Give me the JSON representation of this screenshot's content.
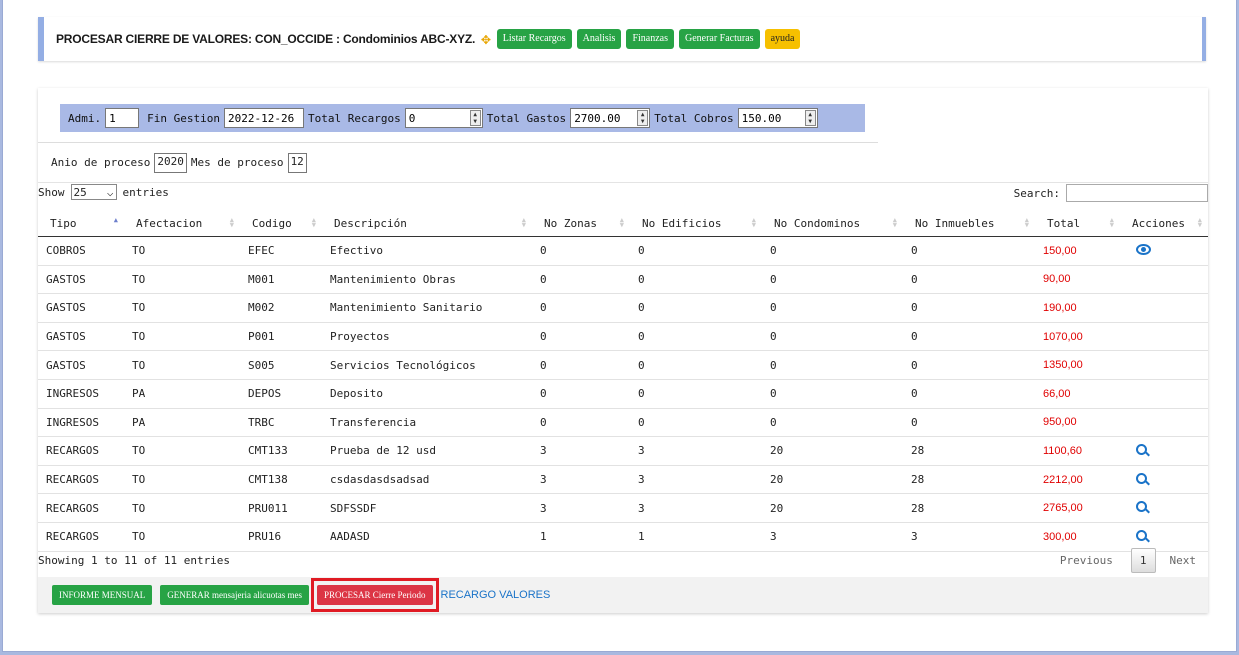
{
  "header": {
    "title": "PROCESAR CIERRE DE VALORES: CON_OCCIDE : Condominios ABC-XYZ.",
    "buttons": [
      "Listar Recargos",
      "Analisis",
      "Finanzas",
      "Generar Facturas"
    ],
    "help": "ayuda"
  },
  "params": {
    "admi_label": "Admi.",
    "admi_value": "1",
    "fin_label": "Fin Gestion",
    "fin_value": "2022-12-26",
    "recargos_label": "Total Recargos",
    "recargos_value": "0",
    "gastos_label": "Total Gastos",
    "gastos_value": "2700.00",
    "cobros_label": "Total Cobros",
    "cobros_value": "150.00",
    "anio_label": "Anio de proceso",
    "anio_value": "2020",
    "mes_label": "Mes de proceso",
    "mes_value": "12"
  },
  "table_controls": {
    "show": "Show",
    "entries_value": "25",
    "entries": "entries",
    "search_label": "Search:"
  },
  "table": {
    "columns": [
      "Tipo",
      "Afectacion",
      "Codigo",
      "Descripción",
      "No Zonas",
      "No Edificios",
      "No Condominos",
      "No Inmuebles",
      "Total",
      "Acciones"
    ],
    "rows": [
      {
        "tipo": "COBROS",
        "afect": "TO",
        "codigo": "EFEC",
        "desc": "Efectivo",
        "zonas": "0",
        "edif": "0",
        "cond": "0",
        "inm": "0",
        "total": "150,00",
        "action": "eye-icon"
      },
      {
        "tipo": "GASTOS",
        "afect": "TO",
        "codigo": "M001",
        "desc": "Mantenimiento Obras",
        "zonas": "0",
        "edif": "0",
        "cond": "0",
        "inm": "0",
        "total": "90,00",
        "action": ""
      },
      {
        "tipo": "GASTOS",
        "afect": "TO",
        "codigo": "M002",
        "desc": "Mantenimiento Sanitario",
        "zonas": "0",
        "edif": "0",
        "cond": "0",
        "inm": "0",
        "total": "190,00",
        "action": ""
      },
      {
        "tipo": "GASTOS",
        "afect": "TO",
        "codigo": "P001",
        "desc": "Proyectos",
        "zonas": "0",
        "edif": "0",
        "cond": "0",
        "inm": "0",
        "total": "1070,00",
        "action": ""
      },
      {
        "tipo": "GASTOS",
        "afect": "TO",
        "codigo": "S005",
        "desc": "Servicios Tecnológicos",
        "zonas": "0",
        "edif": "0",
        "cond": "0",
        "inm": "0",
        "total": "1350,00",
        "action": ""
      },
      {
        "tipo": "INGRESOS",
        "afect": "PA",
        "codigo": "DEPOS",
        "desc": "Deposito",
        "zonas": "0",
        "edif": "0",
        "cond": "0",
        "inm": "0",
        "total": "66,00",
        "action": ""
      },
      {
        "tipo": "INGRESOS",
        "afect": "PA",
        "codigo": "TRBC",
        "desc": "Transferencia",
        "zonas": "0",
        "edif": "0",
        "cond": "0",
        "inm": "0",
        "total": "950,00",
        "action": ""
      },
      {
        "tipo": "RECARGOS",
        "afect": "TO",
        "codigo": "CMT133",
        "desc": "Prueba de 12 usd",
        "zonas": "3",
        "edif": "3",
        "cond": "20",
        "inm": "28",
        "total": "1100,60",
        "action": "search-icon"
      },
      {
        "tipo": "RECARGOS",
        "afect": "TO",
        "codigo": "CMT138",
        "desc": "csdasdasdsadsad",
        "zonas": "3",
        "edif": "3",
        "cond": "20",
        "inm": "28",
        "total": "2212,00",
        "action": "search-icon"
      },
      {
        "tipo": "RECARGOS",
        "afect": "TO",
        "codigo": "PRU011",
        "desc": "SDFSSDF",
        "zonas": "3",
        "edif": "3",
        "cond": "20",
        "inm": "28",
        "total": "2765,00",
        "action": "search-icon"
      },
      {
        "tipo": "RECARGOS",
        "afect": "TO",
        "codigo": "PRU16",
        "desc": "AADASD",
        "zonas": "1",
        "edif": "1",
        "cond": "3",
        "inm": "3",
        "total": "300,00",
        "action": "search-icon"
      }
    ]
  },
  "footer": {
    "info": "Showing 1 to 11 of 11 entries",
    "previous": "Previous",
    "page": "1",
    "next": "Next"
  },
  "actions": {
    "informe": "INFORME MENSUAL",
    "generar": "GENERAR mensajeria alicuotas mes",
    "procesar": "PROCESAR Cierre Periodo",
    "recargo_link": "RECARGO VALORES"
  },
  "colors": {
    "green": "#27a345",
    "yellow": "#f6c000",
    "red": "#dc3545",
    "total_red": "#e00000",
    "param_bg": "#a9b9e6"
  }
}
